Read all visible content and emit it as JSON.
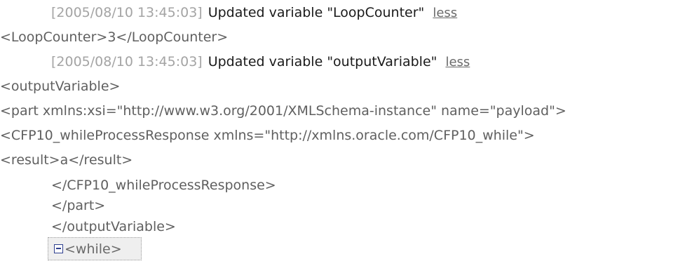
{
  "entries": [
    {
      "timestamp": "[2005/08/10 13:45:03]",
      "message": "Updated variable \"LoopCounter\"",
      "toggle_label": "less"
    },
    {
      "timestamp": "[2005/08/10 13:45:03]",
      "message": "Updated variable \"outputVariable\"",
      "toggle_label": "less"
    }
  ],
  "xml_lines": {
    "loop_counter": "<LoopCounter>3</LoopCounter>",
    "output_open": "<outputVariable>",
    "part_open": "<part xmlns:xsi=\"http://www.w3.org/2001/XMLSchema-instance\" name=\"payload\">",
    "response_open": "<CFP10_whileProcessResponse xmlns=\"http://xmlns.oracle.com/CFP10_while\">",
    "result": "<result>a</result>",
    "response_close": "</CFP10_whileProcessResponse>",
    "part_close": "</part>",
    "output_close": "</outputVariable>"
  },
  "tree_node": {
    "label": "<while>",
    "icon": "collapse-minus-icon"
  },
  "colors": {
    "timestamp": "#a4a4a4",
    "message": "#1a1a1a",
    "xml_text": "#5f5f5f",
    "icon_accent": "#2e3f8f",
    "node_background": "#efefef"
  }
}
